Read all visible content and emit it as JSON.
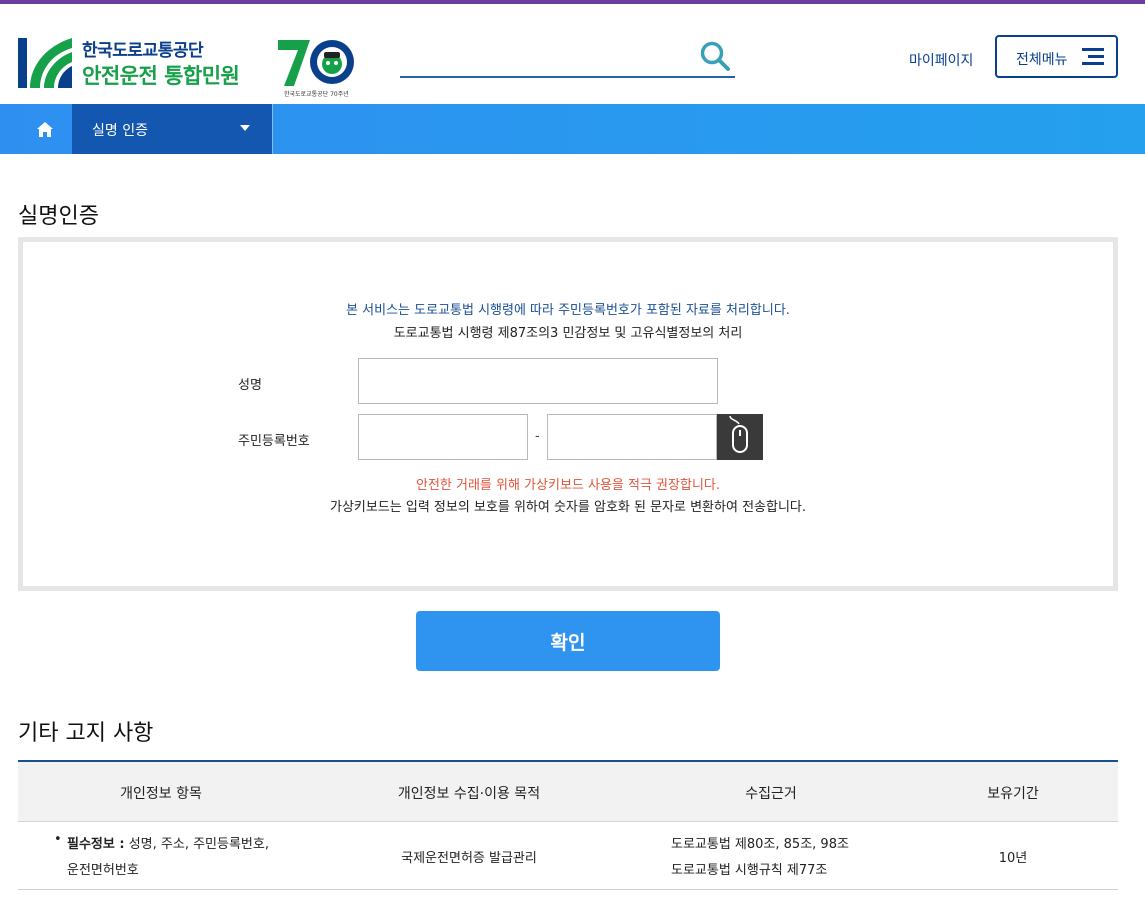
{
  "colors": {
    "brand_blue": "#0a3f8c",
    "brand_green": "#17a04a",
    "nav_blue": "#2f8ff0",
    "nav_active": "#1357b0",
    "button_blue": "#2f93f0",
    "warning_red": "#e0553a",
    "top_line": "#6a3fa0"
  },
  "header": {
    "logo_line1": "한국도로교통공단",
    "logo_line2": "안전운전 통합민원",
    "anniversary_text": "7O",
    "anniversary_caption": "한국도로교통공단 70주년",
    "search_placeholder": "",
    "search_icon": "search-icon",
    "mypage_label": "마이페이지",
    "allmenu_label": "전체메뉴",
    "allmenu_icon": "hamburger-icon"
  },
  "nav": {
    "home_icon": "home-icon",
    "current_label": "실명 인증",
    "dropdown_icon": "chevron-down-icon"
  },
  "main": {
    "page_title": "실명인증",
    "notice_line1": "본 서비스는 도로교통법 시행령에 따라 주민등록번호가 포함된 자료를 처리합니다.",
    "notice_line2": "도로교통법 시행령 제87조의3 민감정보 및 고유식별정보의 처리",
    "name_label": "성명",
    "name_value": "",
    "rrn_label": "주민등록번호",
    "rrn_front_value": "",
    "rrn_separator": "-",
    "rrn_back_value": "",
    "virtual_keyboard_icon": "mouse-icon",
    "warning_line1": "안전한 거래를 위해 가상키보드 사용을 적극 권장합니다.",
    "warning_line2": "가상키보드는 입력 정보의 보호를 위하여 숫자를 암호화 된 문자로 변환하여 전송합니다.",
    "confirm_label": "확인"
  },
  "notice_section": {
    "title": "기타 고지 사항",
    "columns": [
      "개인정보 항목",
      "개인정보 수집·이용 목적",
      "수집근거",
      "보유기간"
    ],
    "row": {
      "bullet": "•",
      "required_label": "필수정보 :",
      "items_line1": " 성명, 주소, 주민등록번호,",
      "items_line2": "운전면허번호",
      "purpose": "국제운전면허증 발급관리",
      "basis_line1": "도로교통법 제80조, 85조, 98조",
      "basis_line2": "도로교통법 시행규칙 제77조",
      "retention": "10년"
    }
  }
}
